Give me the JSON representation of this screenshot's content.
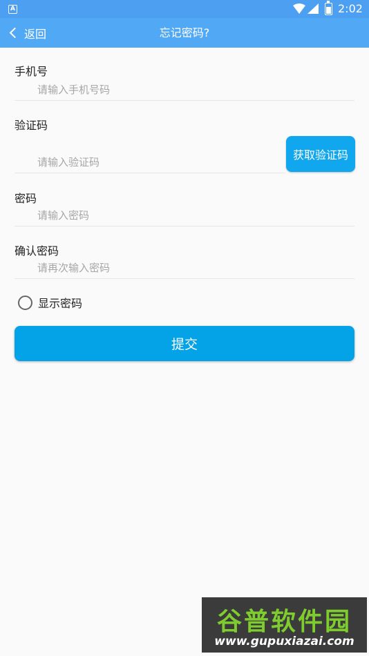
{
  "status_bar": {
    "notification_icon": "A",
    "time": "2:02",
    "icons": [
      "wifi-icon",
      "signal-icon",
      "battery-icon"
    ]
  },
  "app_bar": {
    "back_label": "返回",
    "title": "忘记密码?",
    "color": "#51a9f5"
  },
  "form": {
    "phone": {
      "label": "手机号",
      "placeholder": "请输入手机号码",
      "value": ""
    },
    "code": {
      "label": "验证码",
      "placeholder": "请输入验证码",
      "value": "",
      "button_label": "获取验证码"
    },
    "password": {
      "label": "密码",
      "placeholder": "请输入密码",
      "value": ""
    },
    "confirm": {
      "label": "确认密码",
      "placeholder": "请再次输入密码",
      "value": ""
    },
    "show_password": {
      "label": "显示密码",
      "checked": false
    },
    "submit_label": "提交",
    "button_color": "#04a3e8"
  },
  "watermark": {
    "brand": "谷普软件园",
    "url": "www.gupuxiazai.com"
  }
}
